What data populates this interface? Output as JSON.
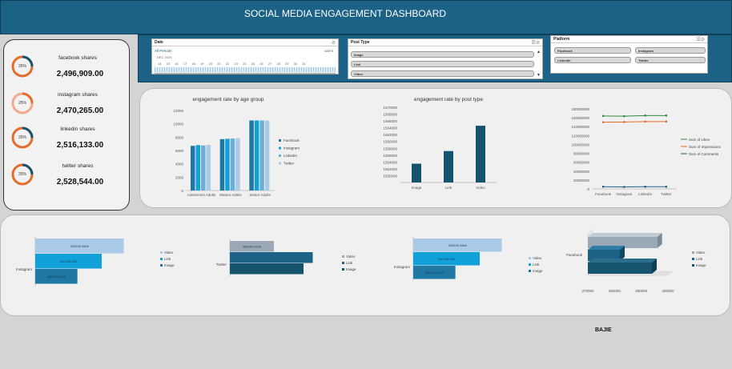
{
  "header": {
    "title": "SOCIAL MEDIA ENGAGEMENT DASHBOARD"
  },
  "colors": {
    "header": "#1c6286",
    "accent_orange": "#e46c2c",
    "facebook": "#1f77a4",
    "instagram": "#12a0d8",
    "linkedin": "#6ab0d6",
    "twitter": "#a9cbe8",
    "dark": "#16546e"
  },
  "slicers": {
    "date": {
      "title": "Date",
      "periods": "All Periods",
      "unit": "DAYS",
      "month": "DEC 2024",
      "days": [
        "14",
        "15",
        "16",
        "17",
        "18",
        "19",
        "20",
        "21",
        "22",
        "23",
        "24",
        "25",
        "26",
        "27",
        "28",
        "29",
        "30",
        "31"
      ]
    },
    "post_type": {
      "title": "Post Type",
      "items": [
        "Image",
        "Link",
        "Video"
      ]
    },
    "platform": {
      "title": "Platform",
      "items": [
        "Facebook",
        "Instagram",
        "LinkedIn",
        "Twitter"
      ]
    }
  },
  "kpis": [
    {
      "label": "facebook shares",
      "value": "2,496,909.00",
      "pct": "25%",
      "fraction": 0.25
    },
    {
      "label": "instagram shares",
      "value": "2,470,265.00",
      "pct": "25%",
      "fraction": 0.25
    },
    {
      "label": "linkedin shares",
      "value": "2,516,133.00",
      "pct": "25%",
      "fraction": 0.25
    },
    {
      "label": "twitter shares",
      "value": "2,528,544.00",
      "pct": "25%",
      "fraction": 0.25
    }
  ],
  "chart_data": [
    {
      "type": "bar",
      "title": "engagement rate by age group",
      "categories": [
        "Adolescent Adults",
        "Mature Adults",
        "Senior Adults"
      ],
      "series": [
        {
          "name": "Facebook",
          "values": [
            6700,
            7700,
            10500
          ]
        },
        {
          "name": "Instagram",
          "values": [
            6800,
            7750,
            10500
          ]
        },
        {
          "name": "LinkedIn",
          "values": [
            6750,
            7800,
            10500
          ]
        },
        {
          "name": "Twitter",
          "values": [
            6850,
            7850,
            10500
          ]
        }
      ],
      "ylim": [
        0,
        12000
      ],
      "yticks": [
        "0",
        "2000",
        "4000",
        "6000",
        "8000",
        "10000",
        "12000"
      ],
      "legend": "right"
    },
    {
      "type": "bar",
      "title": "engagement rate by post type",
      "categories": [
        "Image",
        "Link",
        "Video"
      ],
      "values": [
        1553500,
        1557200,
        1564600
      ],
      "ylim": [
        1548000,
        1570000
      ],
      "yticks": [
        "1548000",
        "1550000",
        "1552000",
        "1554000",
        "1556000",
        "1558000",
        "1560000",
        "1562000",
        "1564000",
        "1566000",
        "1568000",
        "1570000"
      ],
      "yticks_display": [
        "1550000",
        "1552000",
        "1554000",
        "1556000",
        "1558000",
        "1560000",
        "1562000",
        "1564000",
        "1566000",
        "1568000",
        "1570000"
      ]
    },
    {
      "type": "line",
      "categories": [
        "Facebook",
        "Instagram",
        "LinkedIn",
        "Twitter"
      ],
      "series": [
        {
          "name": "Sum of Likes",
          "values": [
            164000000,
            163500000,
            165000000,
            165000000
          ]
        },
        {
          "name": "Sum of Impressions",
          "values": [
            150000000,
            150500000,
            151500000,
            151500000
          ]
        },
        {
          "name": "Sum of Comments",
          "values": [
            5000000,
            4500000,
            5000000,
            5000000
          ]
        }
      ],
      "ylim": [
        0,
        180000000
      ],
      "yticks": [
        "0",
        "20000000",
        "40000000",
        "60000000",
        "80000000",
        "100000000",
        "120000000",
        "140000000",
        "160000000",
        "180000000"
      ],
      "legend": "right"
    },
    {
      "type": "bar",
      "orientation": "horizontal",
      "categories": [
        "Instagram"
      ],
      "series": [
        {
          "name": "Video",
          "values": [
            393590.4866
          ],
          "label": "393590.4866"
        },
        {
          "name": "Link",
          "values": [
            390205.0
          ],
          "label": "390205.000"
        },
        {
          "name": "Image",
          "values": [
            386469.0
          ],
          "label": "386469.0000"
        }
      ],
      "legend": "right"
    },
    {
      "type": "bar",
      "orientation": "horizontal",
      "categories": [
        "Twitter"
      ],
      "series": [
        {
          "name": "Video",
          "values": [
            389560.0018
          ],
          "label": "389560.0018"
        },
        {
          "name": "Link",
          "values": [
            398000
          ]
        },
        {
          "name": "Image",
          "values": [
            396000
          ]
        }
      ],
      "legend": "right"
    },
    {
      "type": "bar",
      "orientation": "horizontal",
      "categories": [
        "Instagram"
      ],
      "series": [
        {
          "name": "Video",
          "values": [
            393590.4866
          ],
          "label": "393590.4866"
        },
        {
          "name": "Link",
          "values": [
            390205.0
          ],
          "label": "390205.000"
        },
        {
          "name": "Image",
          "values": [
            386469.0
          ],
          "label": "386469.0000"
        }
      ],
      "legend": "right"
    },
    {
      "type": "bar",
      "orientation": "horizontal",
      "style": "3d",
      "categories": [
        "Facebook"
      ],
      "series": [
        {
          "name": "Video",
          "values": [
            396000
          ]
        },
        {
          "name": "Link",
          "values": [
            382000
          ]
        },
        {
          "name": "Image",
          "values": [
            394000
          ]
        }
      ],
      "xticks": [
        "370000",
        "380000",
        "390000",
        "400000"
      ],
      "xlim": [
        370000,
        400000
      ],
      "legend": "right"
    }
  ],
  "footer": {
    "author": "BAJIE"
  }
}
